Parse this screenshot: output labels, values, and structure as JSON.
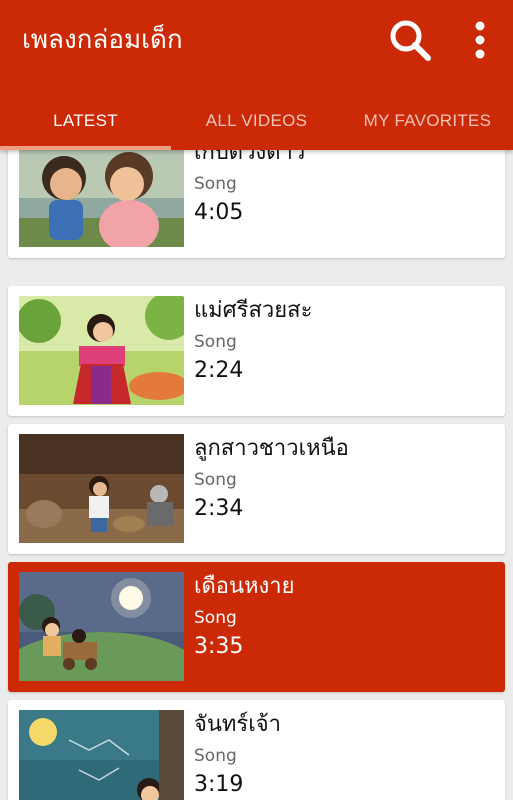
{
  "app": {
    "title": "เพลงกล่อมเด็ก"
  },
  "icons": {
    "search": "search-icon",
    "more": "more-vert-icon"
  },
  "colors": {
    "primary": "#cc2a06",
    "tab_indicator": "#f0a080",
    "background": "#ececec"
  },
  "tabs": [
    {
      "label": "LATEST",
      "active": true
    },
    {
      "label": "ALL VIDEOS",
      "active": false
    },
    {
      "label": "MY FAVORITES",
      "active": false
    }
  ],
  "videos": [
    {
      "title": "เก็บดวงดาว",
      "type": "Song",
      "duration": "4:05",
      "selected": false
    },
    {
      "title": "แม่ศรีสวยสะ",
      "type": "Song",
      "duration": "2:24",
      "selected": false
    },
    {
      "title": "ลูกสาวชาวเหนือ",
      "type": "Song",
      "duration": "2:34",
      "selected": false
    },
    {
      "title": "เดือนหงาย",
      "type": "Song",
      "duration": "3:35",
      "selected": true
    },
    {
      "title": "จันทร์เจ้า",
      "type": "Song",
      "duration": "3:19",
      "selected": false
    }
  ]
}
